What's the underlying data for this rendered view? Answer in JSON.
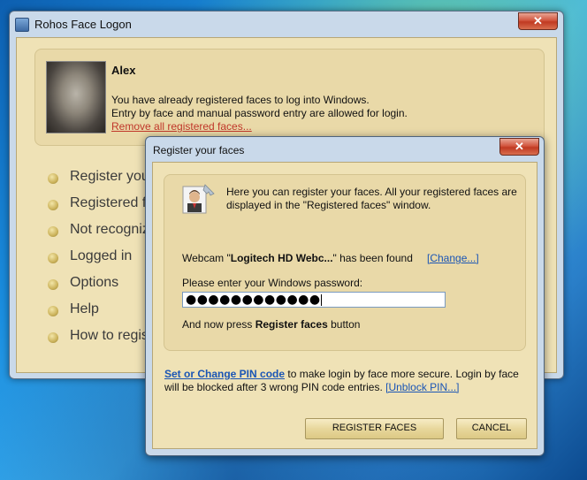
{
  "main_window": {
    "title": "Rohos Face Logon",
    "close_label": "✕",
    "user": {
      "name": "Alex",
      "line1": "You have already registered faces to log into Windows.",
      "line2": "Entry by face and manual password entry are allowed for login.",
      "remove_link": "Remove all registered faces..."
    },
    "menu": [
      {
        "label": "Register you"
      },
      {
        "label": "Registered fa"
      },
      {
        "label": "Not recogniz"
      },
      {
        "label": "Logged in"
      },
      {
        "label": "Options"
      },
      {
        "label": "Help"
      },
      {
        "label": "How to regis"
      }
    ]
  },
  "dialog": {
    "title": "Register your faces",
    "close_label": "✕",
    "intro": "Here you can register your faces. All your registered faces are displayed in the \"Registered faces\" window.",
    "webcam_prefix": "Webcam \"",
    "webcam_name": "Logitech HD Webc...",
    "webcam_suffix": "\" has been found",
    "change_link": "[Change...]",
    "password_label": "Please enter your Windows password:",
    "password_value": "●●●●●●●●●●●●",
    "press_prefix": "And now press ",
    "press_bold": "Register faces",
    "press_suffix": " button",
    "pin_link": "Set or Change PIN code",
    "pin_text": " to make login by face more secure. Login by face will be blocked after 3 wrong PIN code entries. ",
    "unblock_link": "[Unblock PIN...]",
    "register_button": "REGISTER FACES",
    "cancel_button": "CANCEL"
  }
}
